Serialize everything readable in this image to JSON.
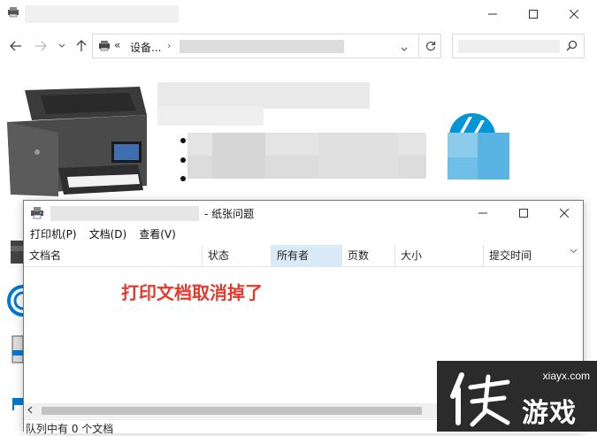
{
  "explorer": {
    "address_chevron": "«",
    "address_text": "设备...",
    "address_separator": "›"
  },
  "dialog": {
    "title_suffix": "- 纸张问题",
    "menu": [
      "打印机(P)",
      "文档(D)",
      "查看(V)"
    ],
    "columns": [
      "文档名",
      "状态",
      "所有者",
      "页数",
      "大小",
      "提交时间"
    ],
    "sorted_column": "所有者",
    "status_text": "队列中有 0 个文档",
    "annotation": "打印文档取消掉了"
  },
  "watermark": {
    "url": "xiayx.com",
    "text": "游戏"
  },
  "colors": {
    "annotation": "#e33b2e",
    "sorted_header": "#d9ebf9",
    "hp_blue": "#0096d6"
  }
}
